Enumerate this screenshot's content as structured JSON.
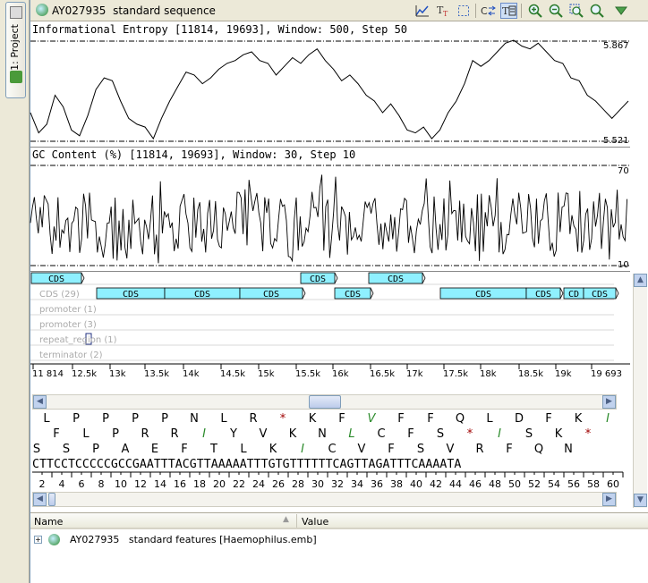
{
  "project_strip": {
    "label": "1: Project"
  },
  "sequence": {
    "id": "AY027935",
    "name": "standard sequence"
  },
  "toolbar": {
    "buttons": [
      "chart-icon",
      "text-style-icon",
      "select-region-icon",
      "swap-icon",
      "translate-icon",
      "zoom-in-icon",
      "zoom-out-icon",
      "zoom-fit-icon",
      "zoom-region-icon",
      "dropdown-icon"
    ],
    "active": "translate-icon"
  },
  "entropy_graph": {
    "title": "Informational Entropy [11814, 19693], Window: 500, Step 50",
    "max_label": "5.867",
    "min_label": "5.521",
    "values": [
      5.62,
      5.55,
      5.58,
      5.68,
      5.64,
      5.56,
      5.54,
      5.61,
      5.7,
      5.74,
      5.73,
      5.66,
      5.6,
      5.58,
      5.57,
      5.53,
      5.6,
      5.66,
      5.71,
      5.76,
      5.75,
      5.72,
      5.74,
      5.77,
      5.79,
      5.8,
      5.82,
      5.83,
      5.8,
      5.79,
      5.75,
      5.78,
      5.81,
      5.79,
      5.82,
      5.84,
      5.8,
      5.77,
      5.73,
      5.75,
      5.72,
      5.68,
      5.66,
      5.62,
      5.65,
      5.61,
      5.56,
      5.55,
      5.57,
      5.53,
      5.56,
      5.62,
      5.66,
      5.72,
      5.8,
      5.78,
      5.8,
      5.83,
      5.86,
      5.87,
      5.85,
      5.84,
      5.86,
      5.83,
      5.8,
      5.79,
      5.74,
      5.73,
      5.68,
      5.66,
      5.63,
      5.6,
      5.63,
      5.66
    ]
  },
  "gc_graph": {
    "title": "GC Content (%) [11814, 19693], Window: 30, Step 10",
    "max_label": "70",
    "min_label": "10"
  },
  "features": {
    "rows": [
      {
        "label": "CDS (29)"
      },
      {
        "label": "promoter (1)"
      },
      {
        "label": "promoter (3)"
      },
      {
        "label": "repeat_region (1)"
      },
      {
        "label": "terminator (2)"
      }
    ],
    "cds_label": "CDS",
    "cds_short": "CD"
  },
  "ruler": {
    "ticks": [
      "11 814",
      "12.5k",
      "13k",
      "13.5k",
      "14k",
      "14.5k",
      "15k",
      "15.5k",
      "16k",
      "16.5k",
      "17k",
      "17.5k",
      "18k",
      "18.5k",
      "19k",
      "19 693"
    ]
  },
  "translation": {
    "frame1": [
      "L",
      "P",
      "P",
      "P",
      "P",
      "N",
      "L",
      "R",
      "*",
      "K",
      "F",
      "V",
      "F",
      "F",
      "Q",
      "L",
      "D",
      "F",
      "K",
      "I"
    ],
    "frame2": [
      "F",
      "L",
      "P",
      "R",
      "R",
      "I",
      "Y",
      "V",
      "K",
      "N",
      "L",
      "C",
      "F",
      "S",
      "*",
      "I",
      "S",
      "K",
      "*"
    ],
    "frame3": [
      "S",
      "S",
      "P",
      "A",
      "E",
      "F",
      "T",
      "L",
      "K",
      "I",
      "C",
      "V",
      "F",
      "S",
      "V",
      "R",
      "F",
      "Q",
      "N"
    ],
    "nucleotides": "CTTCCTCCCCCGCCGAATTTACGTTAAAAATTTGTGTTTTTTCAGTTAGATTTCAAAATA",
    "positions": [
      "12",
      "14",
      "16",
      "18",
      "20",
      "22",
      "24",
      "26",
      "28",
      "30",
      "32",
      "34",
      "36",
      "38",
      "40",
      "42",
      "44",
      "46",
      "48",
      "50",
      "52",
      "54",
      "56",
      "58",
      "60"
    ],
    "position_prefix": [
      "2",
      "4",
      "6",
      "8",
      "10"
    ]
  },
  "feature_table": {
    "columns": [
      "Name",
      "Value"
    ],
    "row": "AY027935   standard features [Haemophilus.emb]"
  }
}
